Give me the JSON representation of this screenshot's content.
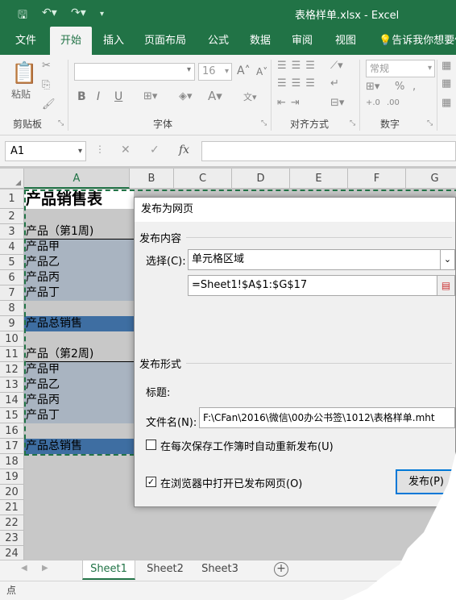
{
  "window": {
    "title": "表格样单.xlsx - Excel"
  },
  "ribbon_tabs": [
    "文件",
    "开始",
    "插入",
    "页面布局",
    "公式",
    "数据",
    "审阅",
    "视图",
    "告诉我你想要做"
  ],
  "ribbon": {
    "paste_label": "粘贴",
    "groups": [
      "剪贴板",
      "字体",
      "对齐方式",
      "数字"
    ],
    "font_size": "16",
    "number_format": "常规",
    "bold": "B",
    "italic": "I",
    "underline": "U"
  },
  "formula_bar": {
    "name_box": "A1",
    "fx": "fx"
  },
  "columns": [
    "A",
    "B",
    "C",
    "D",
    "E",
    "F",
    "G"
  ],
  "rows": [
    "1",
    "2",
    "3",
    "4",
    "5",
    "6",
    "7",
    "8",
    "9",
    "10",
    "11",
    "12",
    "13",
    "14",
    "15",
    "16",
    "17",
    "18",
    "19",
    "20",
    "21",
    "22",
    "23",
    "24"
  ],
  "cells": {
    "a1": "产品销售表",
    "a3": "产品（第1周)",
    "a4": "产品甲",
    "a5": "产品乙",
    "a6": "产品丙",
    "a7": "产品丁",
    "a9": "产品总销售",
    "a11": "产品（第2周)",
    "a12": "产品甲",
    "a13": "产品乙",
    "a14": "产品丙",
    "a15": "产品丁",
    "a17": "产品总销售"
  },
  "dialog": {
    "title": "发布为网页",
    "section_content": "发布内容",
    "select_label": "选择(C):",
    "select_value": "单元格区域",
    "range_value": "=Sheet1!$A$1:$G$17",
    "section_form": "发布形式",
    "title_label": "标题:",
    "filename_label": "文件名(N):",
    "filename_value": "F:\\CFan\\2016\\微信\\00办公书签\\1012\\表格样单.mht",
    "autorepublish_label": "在每次保存工作簿时自动重新发布(U)",
    "autorepublish_checked": false,
    "open_browser_label": "在浏览器中打开已发布网页(O)",
    "open_browser_checked": true,
    "publish_button": "发布(P)"
  },
  "sheets": [
    "Sheet1",
    "Sheet2",
    "Sheet3"
  ],
  "add_sheet": "+",
  "status": "点",
  "colors": {
    "excel_green": "#217346",
    "header_fill": "#3e6ea2",
    "selection_fill": "#a9b4c1"
  }
}
